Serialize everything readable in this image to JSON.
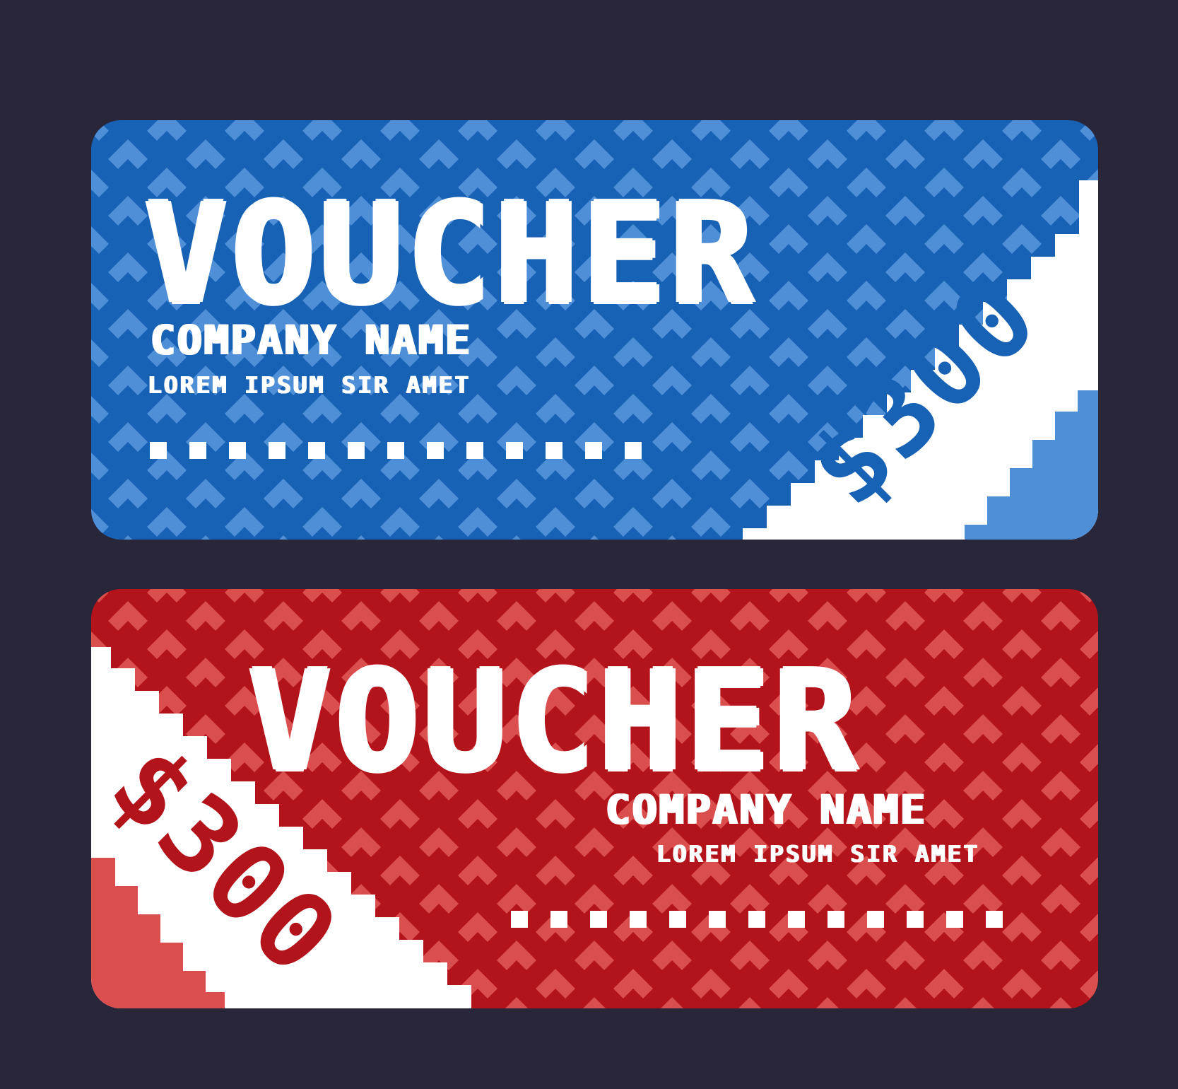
{
  "colors": {
    "page_background": "#29263a",
    "blue_primary": "#1862b6",
    "blue_light": "#4f8fd8",
    "red_primary": "#b3141b",
    "red_light": "#db4e4e",
    "white": "#ffffff"
  },
  "vouchers": [
    {
      "title": "VOUCHER",
      "company": "COMPANY NAME",
      "subtitle": "LOREM IPSUM SIR AMET",
      "amount": "$300"
    },
    {
      "title": "VOUCHER",
      "company": "COMPANY NAME",
      "subtitle": "LOREM IPSUM SIR AMET",
      "amount": "$300"
    }
  ]
}
